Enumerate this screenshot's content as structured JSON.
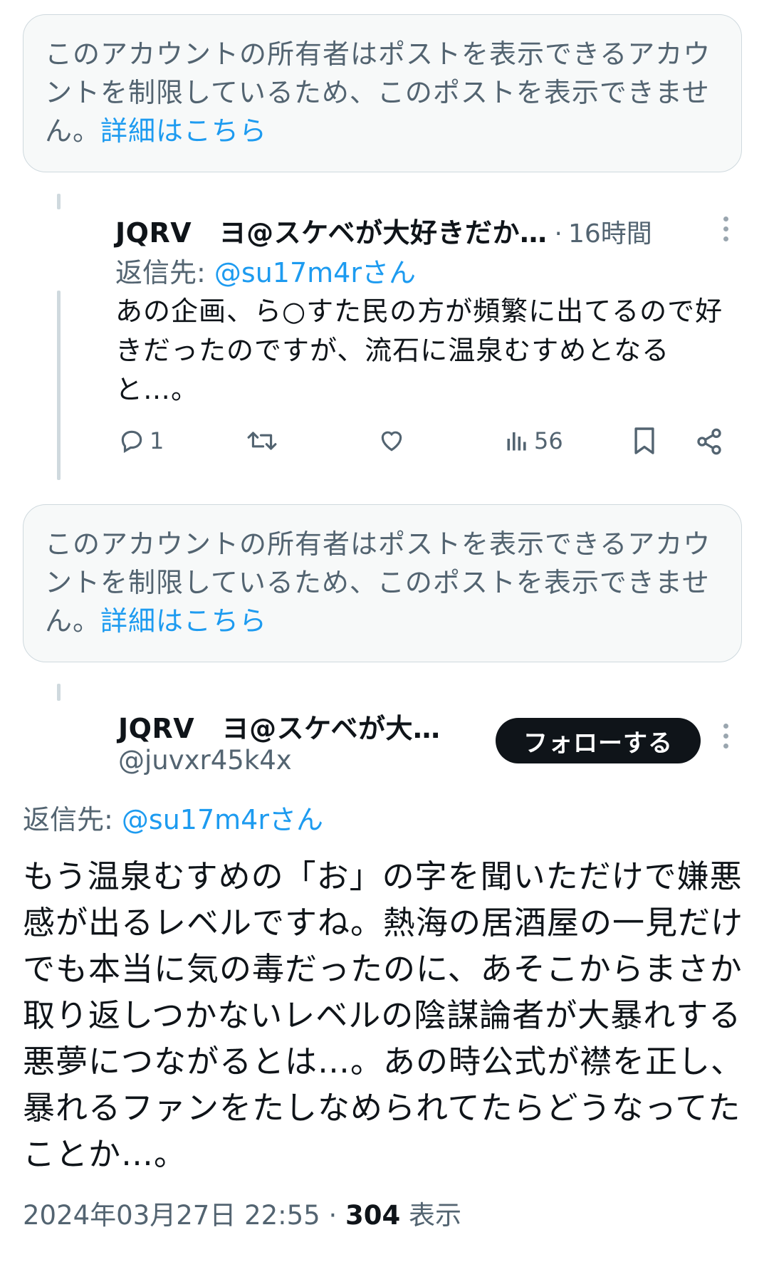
{
  "notices": [
    {
      "text": "このアカウントの所有者はポストを表示できるアカウントを制限しているため、このポストを表示できません。",
      "link": "詳細はこちら"
    },
    {
      "text": "このアカウントの所有者はポストを表示できるアカウントを制限しているため、このポストを表示できません。",
      "link": "詳細はこちら"
    }
  ],
  "reply_post": {
    "display_name": "JQRV　ヨ@スケベが大好きだか…",
    "separator": "·",
    "time": "16時間",
    "reply_to_label": "返信先: ",
    "reply_to_user": "@su17m4rさん",
    "text": "あの企画、ら○すた民の方が頻繁に出てるので好きだったのですが、流石に温泉むすめとなると…。",
    "replies": "1",
    "views": "56",
    "icons": [
      "reply-icon",
      "retweet-icon",
      "like-icon",
      "views-icon",
      "bookmark-icon",
      "share-icon"
    ]
  },
  "main_post": {
    "display_name": "JQRV　ヨ@スケベが大…",
    "handle": "@juvxr45k4x",
    "follow_label": "フォローする",
    "reply_to_label": "返信先: ",
    "reply_to_user": "@su17m4rさん",
    "text": "もう温泉むすめの「お」の字を聞いただけで嫌悪感が出るレベルですね。熱海の居酒屋の一見だけでも本当に気の毒だったのに、あそこからまさか取り返しつかないレベルの陰謀論者が大暴れする悪夢につながるとは…。あの時公式が襟を正し、暴れるファンをたしなめられてたらどうなってたことか…。",
    "timestamp": "2024年03月27日 22:55",
    "separator": "·",
    "view_count": "304",
    "view_label": "表示"
  },
  "colors": {
    "link": "#1d9bf0",
    "muted": "#536471",
    "text": "#0f1419",
    "notice_bg": "#f7f9f9"
  }
}
